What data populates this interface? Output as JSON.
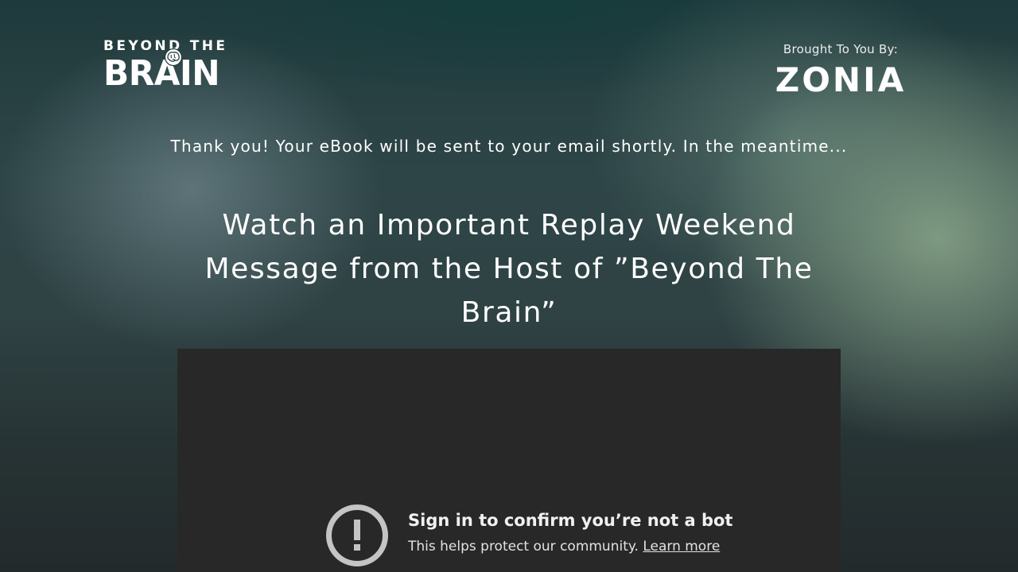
{
  "header": {
    "logo_top": "BEYOND THE",
    "logo_bottom": "BRAIN",
    "logo_icon": "brain-icon",
    "sponsor_label": "Brought To You By:",
    "sponsor_logo": "ZONIA"
  },
  "main": {
    "thanks_message": "Thank you! Your eBook will be sent to your email shortly. In the meantime...",
    "headline": "Watch an Important Replay Weekend Message from the Host of ”Beyond The Brain”"
  },
  "video": {
    "notice_icon": "alert-circle-icon",
    "notice_title": "Sign in to confirm you’re not a bot",
    "notice_text": "This helps protect our community.",
    "notice_link": "Learn more"
  },
  "colors": {
    "video_background": "#282828",
    "text": "#ffffff"
  }
}
